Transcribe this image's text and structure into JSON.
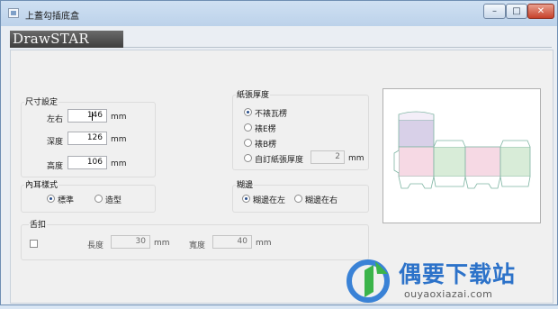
{
  "window": {
    "title": "上蓋勾插底盒",
    "min_glyph": "–",
    "max_glyph": "□",
    "close_glyph": "✕"
  },
  "logo": {
    "text": "DrawSTAR"
  },
  "size_group": {
    "label": "尺寸設定",
    "width": {
      "label": "左右",
      "value": "146",
      "unit": "mm"
    },
    "depth": {
      "label": "深度",
      "value": "126",
      "unit": "mm"
    },
    "height": {
      "label": "高度",
      "value": "106",
      "unit": "mm"
    }
  },
  "paper_group": {
    "label": "紙張厚度",
    "options": [
      "不裱瓦楞",
      "裱E楞",
      "裱B楞",
      "自訂紙張厚度"
    ],
    "selected": "不裱瓦楞",
    "custom_value": "2",
    "custom_unit": "mm"
  },
  "ear_group": {
    "label": "內耳樣式",
    "options": [
      "標準",
      "造型"
    ],
    "selected": "標準"
  },
  "glue_group": {
    "label": "糊邊",
    "options": [
      "糊邊在左",
      "糊邊在右"
    ],
    "selected": "糊邊在左"
  },
  "tongue_group": {
    "label": "舌扣",
    "checked": false,
    "length": {
      "label": "長度",
      "value": "30",
      "unit": "mm"
    },
    "width": {
      "label": "寬度",
      "value": "40",
      "unit": "mm"
    }
  },
  "colors": {
    "lid_panel": "#d8d0e8",
    "pink_panel": "#f6d9e4",
    "green_panel": "#d8ecd8",
    "outline": "#7fb5a3"
  },
  "watermark": {
    "brand": "偶要下载站",
    "url": "ouyaoxiazai.com"
  }
}
